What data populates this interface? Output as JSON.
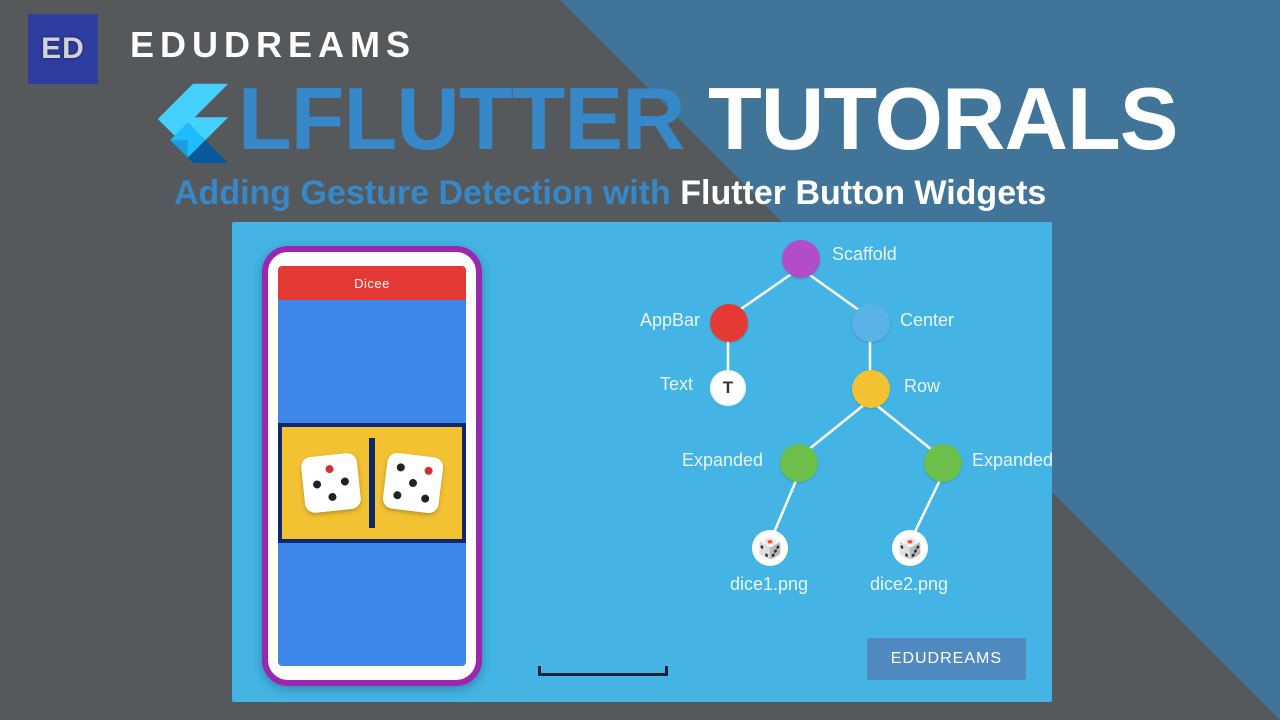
{
  "brand": {
    "logo_text": "ED",
    "top_label": "EDUDREAMS"
  },
  "title": {
    "lflutter": "LFLUTTER",
    "tutorials": "TUTORALS"
  },
  "subtitle": {
    "part1": "Adding Gesture Detection with ",
    "part2": "Flutter Button Widgets"
  },
  "phone": {
    "appbar_title": "Dicee"
  },
  "tree": {
    "scaffold": "Scaffold",
    "appbar": "AppBar",
    "center": "Center",
    "text": "Text",
    "text_glyph": "T",
    "row": "Row",
    "expanded1": "Expanded",
    "expanded2": "Expanded",
    "dice1": "dice1.png",
    "dice2": "dice2.png"
  },
  "button": {
    "label": "EDUDREAMS"
  },
  "colors": {
    "bg_gray": "#55595c",
    "bg_triangle": "#407499",
    "card_blue": "#43b4e4",
    "accent_blue": "#3688c8",
    "phone_border": "#9b27b0",
    "appbar_red": "#e53935",
    "body_blue": "#3f87ea",
    "body_yellow": "#f2c233",
    "node_purple": "#b24dc7",
    "node_red": "#e53935",
    "node_lblue": "#5ab3e4",
    "node_yellow": "#f2c233",
    "node_green": "#6cc04a",
    "btn_blue": "#5189c1"
  }
}
